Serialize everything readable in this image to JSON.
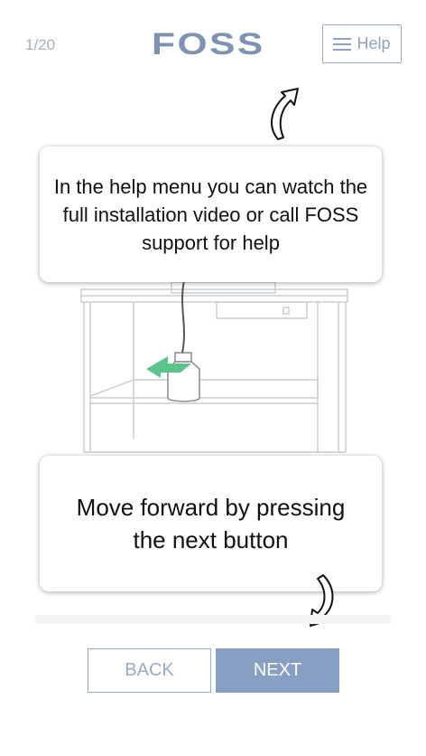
{
  "header": {
    "step_counter": "1/20",
    "logo_text": "FOSS",
    "help_label": "Help"
  },
  "callouts": {
    "help_text": "In the help menu you can watch the full installation video or call FOSS support for help",
    "next_text": "Move forward by pressing the next button"
  },
  "icons": {
    "help": "hamburger-menu-icon",
    "arrow_up": "curved-arrow-up-icon",
    "arrow_down": "curved-arrow-down-icon"
  },
  "footer": {
    "back_label": "BACK",
    "next_label": "NEXT"
  },
  "colors": {
    "brand": "#7d93b2",
    "button_primary": "#879fc3",
    "button_outline": "#9aaac2",
    "accent_green": "#5cc38a"
  }
}
